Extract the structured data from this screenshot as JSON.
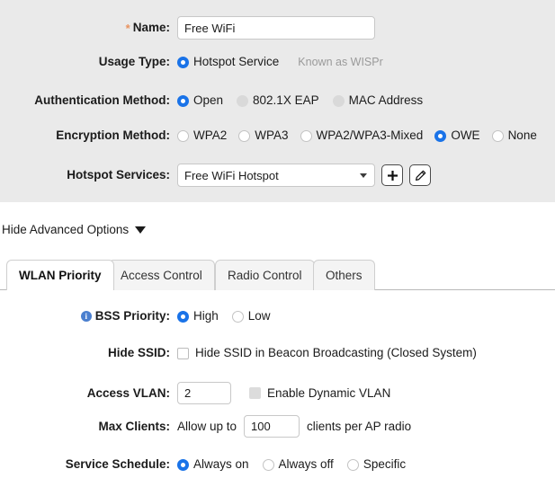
{
  "colors": {
    "panel_bg": "#eaeaea",
    "accent_blue": "#1a73e8",
    "required_star": "#e8925f",
    "info_icon": "#4a7fcf",
    "hint_text": "#9a9a9a"
  },
  "basic_form": {
    "name": {
      "label": "Name:",
      "required_marker": "*",
      "value": "Free WiFi",
      "placeholder": ""
    },
    "usage_type": {
      "label": "Usage Type:",
      "options": [
        {
          "label": "Hotspot Service",
          "selected": true
        }
      ],
      "hint": "Known as WISPr"
    },
    "authentication_method": {
      "label": "Authentication Method:",
      "options": [
        {
          "label": "Open",
          "selected": true,
          "state": "on"
        },
        {
          "label": "802.1X EAP",
          "selected": false,
          "state": "disabled-off"
        },
        {
          "label": "MAC Address",
          "selected": false,
          "state": "disabled-off"
        }
      ]
    },
    "encryption_method": {
      "label": "Encryption Method:",
      "options": [
        {
          "label": "WPA2",
          "selected": false,
          "state": "off"
        },
        {
          "label": "WPA3",
          "selected": false,
          "state": "off"
        },
        {
          "label": "WPA2/WPA3-Mixed",
          "selected": false,
          "state": "off"
        },
        {
          "label": "OWE",
          "selected": true,
          "state": "on"
        },
        {
          "label": "None",
          "selected": false,
          "state": "off"
        }
      ]
    },
    "hotspot_services": {
      "label": "Hotspot Services:",
      "selected_value": "Free WiFi Hotspot",
      "add_button_glyph": "+",
      "edit_button_glyph": "pencil"
    }
  },
  "advanced_toggle": {
    "label": "Hide Advanced Options",
    "caret": "down"
  },
  "tabs": [
    {
      "label": "WLAN Priority",
      "active": true
    },
    {
      "label": "Access Control",
      "active": false
    },
    {
      "label": "Radio Control",
      "active": false
    },
    {
      "label": "Others",
      "active": false
    }
  ],
  "wlan_priority": {
    "bss_priority": {
      "label": "BSS Priority:",
      "info_glyph": "i",
      "options": [
        {
          "label": "High",
          "selected": true,
          "state": "on"
        },
        {
          "label": "Low",
          "selected": false,
          "state": "off"
        }
      ]
    },
    "hide_ssid": {
      "label": "Hide SSID:",
      "checkbox_label": "Hide SSID in Beacon Broadcasting (Closed System)",
      "checked": false,
      "state": "off"
    },
    "access_vlan": {
      "label": "Access VLAN:",
      "value": "2",
      "dynamic_vlan_label": "Enable Dynamic VLAN",
      "dynamic_vlan_checked": false,
      "dynamic_vlan_state": "disabled-off"
    },
    "max_clients": {
      "label": "Max Clients:",
      "prefix_text": "Allow up to",
      "value": "100",
      "suffix_text": "clients per AP radio"
    },
    "service_schedule": {
      "label": "Service Schedule:",
      "options": [
        {
          "label": "Always on",
          "selected": true,
          "state": "on"
        },
        {
          "label": "Always off",
          "selected": false,
          "state": "off"
        },
        {
          "label": "Specific",
          "selected": false,
          "state": "off"
        }
      ]
    }
  }
}
